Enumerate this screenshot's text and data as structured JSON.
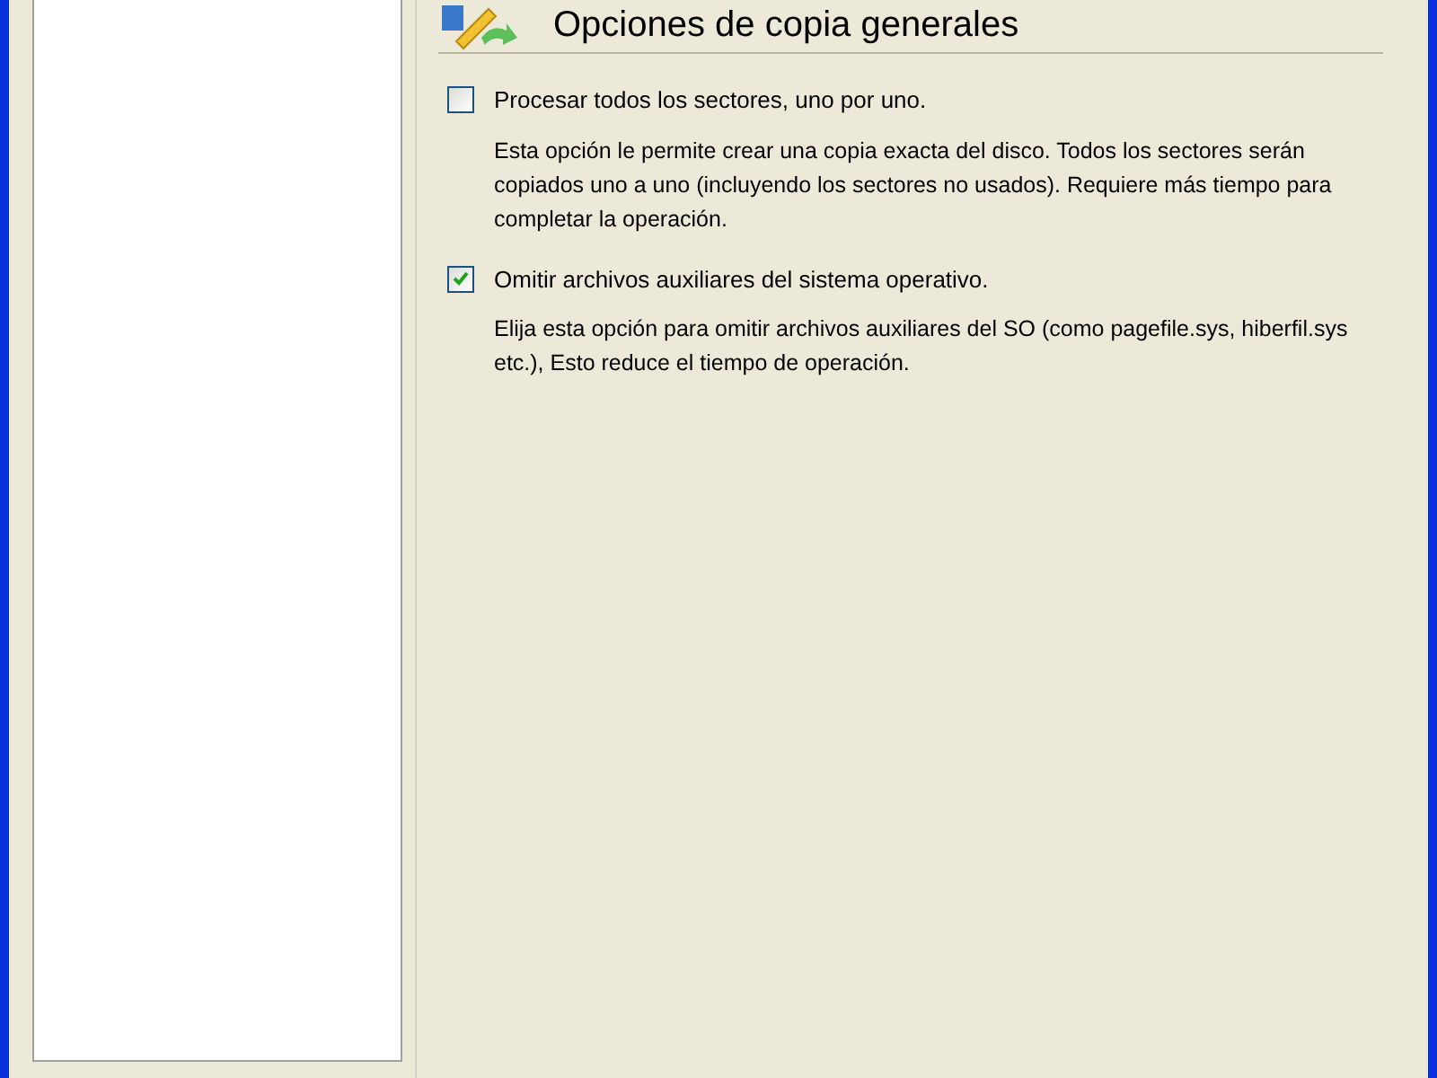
{
  "heading": "Opciones de copia generales",
  "options": [
    {
      "label": "Procesar todos los sectores, uno por uno.",
      "checked": false,
      "description": "Esta opción le permite crear una copia exacta del disco. Todos los sectores serán copiados uno a uno (incluyendo los sectores no usados). Requiere más tiempo para completar la operación."
    },
    {
      "label": "Omitir archivos auxiliares del sistema operativo.",
      "checked": true,
      "description": "Elija esta opción para omitir archivos auxiliares del SO (como pagefile.sys, hiberfil.sys etc.), Esto reduce el tiempo de operación."
    }
  ]
}
